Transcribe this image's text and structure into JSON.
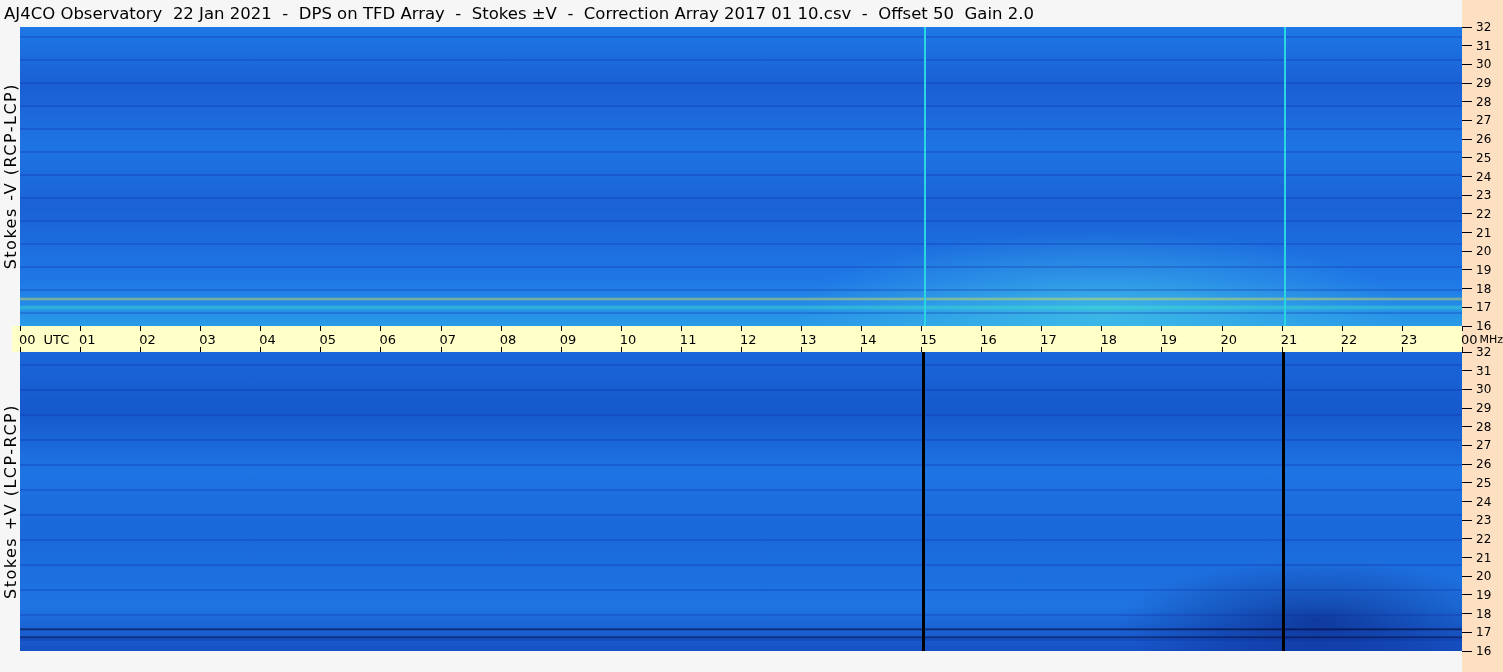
{
  "title": "AJ4CO Observatory  22 Jan 2021  -  DPS on TFD Array  -  Stokes ±V  -  Correction Array 2017 01 10.csv  -  Offset 50  Gain 2.0",
  "panels": [
    {
      "kind": "minus",
      "label": "Stokes -V (RCP-LCP)",
      "frequency_labels": [
        "32",
        "31",
        "30",
        "29",
        "28",
        "27",
        "26",
        "25",
        "24",
        "23",
        "22",
        "21",
        "20",
        "19",
        "18",
        "17",
        "16"
      ]
    },
    {
      "kind": "plus",
      "label": "Stokes +V (LCP-RCP)",
      "frequency_labels": [
        "32",
        "31",
        "30",
        "29",
        "28",
        "27",
        "26",
        "25",
        "24",
        "23",
        "22",
        "21",
        "20",
        "19",
        "18",
        "17",
        "16"
      ]
    }
  ],
  "time_axis": {
    "labels": [
      "00",
      "01",
      "02",
      "03",
      "04",
      "05",
      "06",
      "07",
      "08",
      "09",
      "10",
      "11",
      "12",
      "13",
      "14",
      "15",
      "16",
      "17",
      "18",
      "19",
      "20",
      "21",
      "22",
      "23"
    ],
    "start_unit": "UTC",
    "end_label": "00",
    "end_unit": "MHz"
  }
}
